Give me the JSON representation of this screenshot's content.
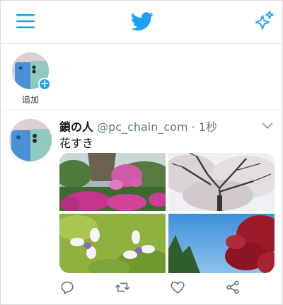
{
  "topbar": {
    "menu_icon": "hamburger-menu-icon",
    "logo_icon": "twitter-bird-icon",
    "sparkle_icon": "sparkle-icon"
  },
  "fleets": {
    "add_label": "追加"
  },
  "tweet": {
    "author_name": "鎖の人",
    "handle": "@pc_chain_com",
    "separator": " · ",
    "time": "1秒",
    "text": "花すき",
    "media": [
      {
        "subject": "pink-azaleas"
      },
      {
        "subject": "cherry-blossom-tree"
      },
      {
        "subject": "white-cyclamen-flowers"
      },
      {
        "subject": "red-maple-blue-sky"
      }
    ]
  },
  "actions": [
    {
      "icon": "reply-icon"
    },
    {
      "icon": "retweet-icon"
    },
    {
      "icon": "like-icon"
    },
    {
      "icon": "share-icon"
    }
  ],
  "colors": {
    "accent": "#1da1f2",
    "text": "#0f1419",
    "muted": "#657786",
    "divider": "#e6ecf0"
  }
}
